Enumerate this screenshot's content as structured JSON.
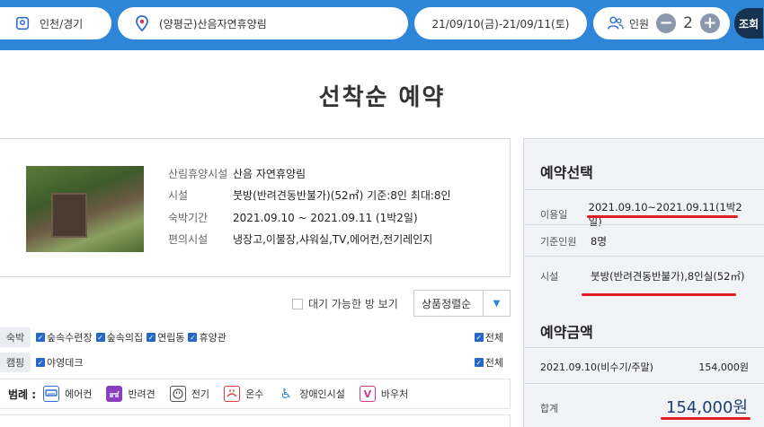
{
  "topbar": {
    "region": "인천/경기",
    "forest": "(양평군)산음자연휴양림",
    "date_range": "21/09/10(금)-21/09/11(토)",
    "people_label": "인원",
    "people_count": "2",
    "minus": "−",
    "plus": "+",
    "search_label": "조회"
  },
  "page_title": "선착순 예약",
  "facility_info": {
    "rows": [
      {
        "label": "산림휴양시설",
        "value": "산음 자연휴양림"
      },
      {
        "label": "시설",
        "value": "붓방(반려견동반불가)(52㎡) 기준:8인 최대:8인"
      },
      {
        "label": "숙박기간",
        "value": "2021.09.10 ~ 2021.09.11 (1박2일)"
      },
      {
        "label": "편의시설",
        "value": "냉장고,이불장,샤워실,TV,에어컨,전기레인지"
      }
    ]
  },
  "filters": {
    "waitlist_label": "대기 가능한 방 보기",
    "sort_label": "상품정렬순",
    "stay": {
      "tag": "숙박",
      "options": [
        "숲속수련장",
        "숲속의집",
        "연립동",
        "휴양관"
      ],
      "all": "전체"
    },
    "camping": {
      "tag": "캠핑",
      "options": [
        "야영데크"
      ],
      "all": "전체"
    }
  },
  "legend": {
    "title": "범례 :",
    "items": [
      {
        "label": "에어컨",
        "icon": "air-conditioner-icon",
        "color": "#2e6fd0"
      },
      {
        "label": "반려견",
        "icon": "dog-icon",
        "color": "#8a3fbf"
      },
      {
        "label": "전기",
        "icon": "plug-icon",
        "color": "#555555"
      },
      {
        "label": "온수",
        "icon": "hot-water-icon",
        "color": "#e03a3a"
      },
      {
        "label": "장애인시설",
        "icon": "wheelchair-icon",
        "color": "#2e86d8"
      },
      {
        "label": "바우처",
        "icon": "voucher-icon",
        "color": "#d03a8a"
      }
    ]
  },
  "summary": {
    "selection_title": "예약선택",
    "use_date_label": "이용일",
    "use_date_value": "2021.09.10~2021.09.11(1박2일)",
    "base_people_label": "기준인원",
    "base_people_value": "8명",
    "facility_label": "시설",
    "facility_value": "붓방(반려견동반불가),8인실(52㎡)",
    "amount_title": "예약금액",
    "line_item_date": "2021.09.10(비수기/주말)",
    "line_item_price": "154,000원",
    "total_label": "합계",
    "total_value": "154,000원"
  },
  "colors": {
    "topbar": "#2e86d8",
    "search_button": "#16324f",
    "highlight": "#e02020",
    "total_price": "#1d3f73"
  }
}
